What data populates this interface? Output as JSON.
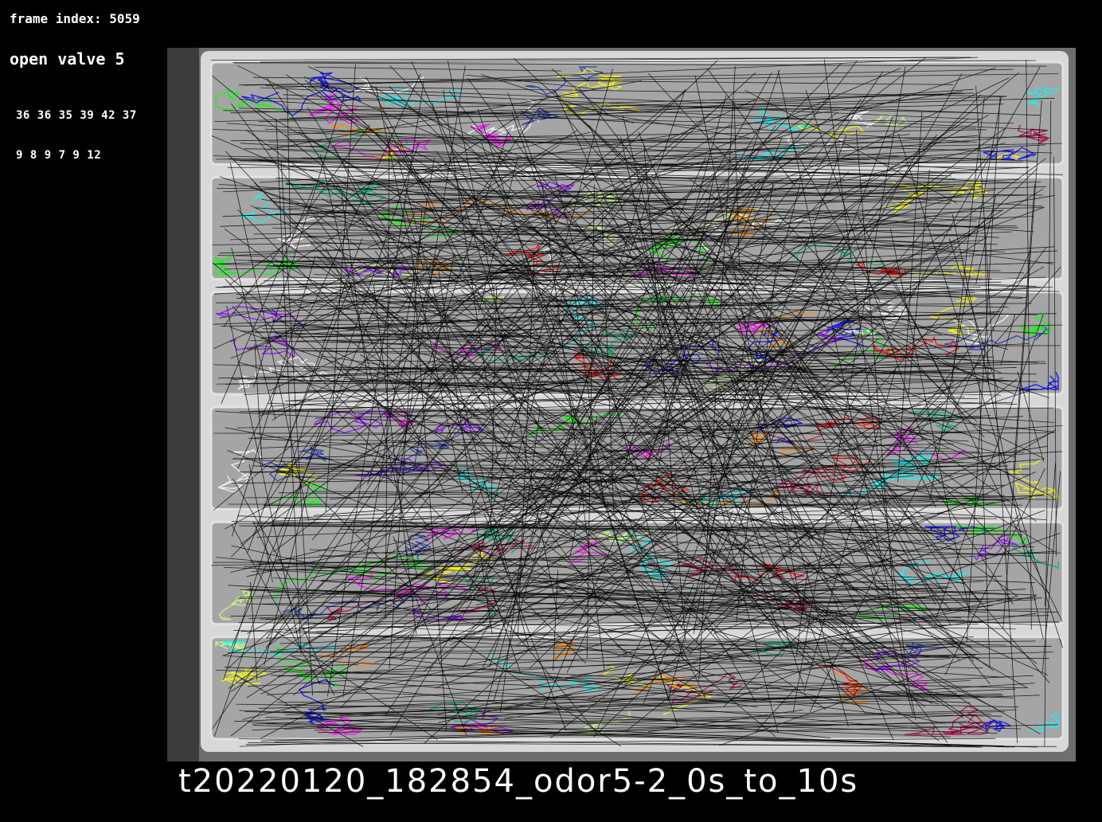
{
  "overlay": {
    "frame_index": "frame index: 5059",
    "valve": "open valve 5",
    "counts_row1": "36 36 35 39 42 37",
    "counts_row2": "9 8 9 7 9 12"
  },
  "caption": "t20220120_182854_odor5-2_0s_to_10s",
  "colors": {
    "background": "#000000",
    "arena_frame": "#6e6e6e",
    "lane_fill": "#a5a5a5",
    "divider": "#e2e2e2",
    "jump_line": "#000000",
    "track_colors": [
      "#ff00ff",
      "#00ff00",
      "#0000ff",
      "#ff0000",
      "#00ffff",
      "#ffff00",
      "#ff8800",
      "#8800ff",
      "#ffffff",
      "#aa0044",
      "#00aa66",
      "#ccff88",
      "#2233aa"
    ]
  },
  "arena": {
    "lanes": 6
  }
}
